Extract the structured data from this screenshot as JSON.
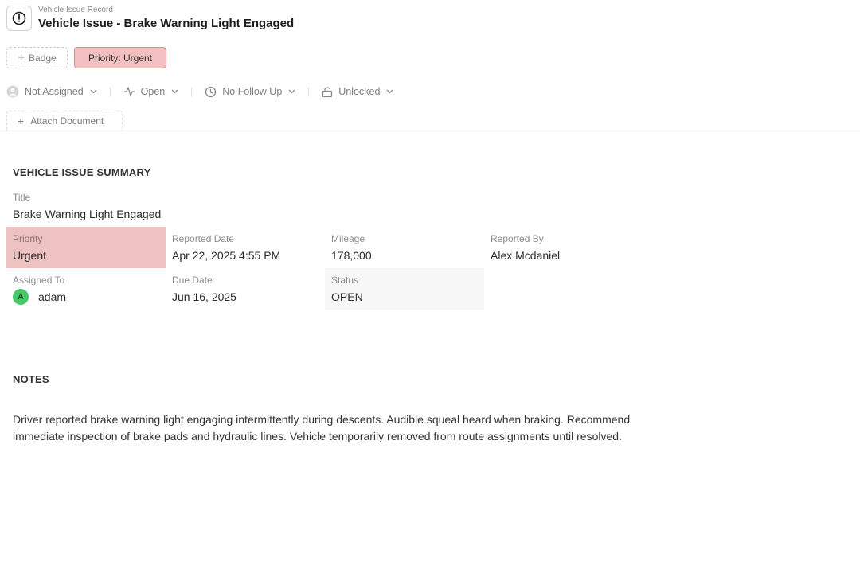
{
  "header": {
    "eyebrow": "Vehicle Issue Record",
    "title": "Vehicle Issue - Brake Warning Light Engaged",
    "icon": "alert-circle-icon"
  },
  "badges": {
    "add_label": "Badge",
    "priority_label": "Priority: Urgent",
    "priority_color": "#f2c0c0"
  },
  "meta": {
    "assignment": "Not Assigned",
    "status": "Open",
    "follow_up": "No Follow Up",
    "lock": "Unlocked"
  },
  "attach": {
    "label": "Attach Document"
  },
  "summary": {
    "heading": "VEHICLE ISSUE SUMMARY",
    "title_label": "Title",
    "title_value": "Brake Warning Light Engaged",
    "priority_label": "Priority",
    "priority_value": "Urgent",
    "reported_date_label": "Reported Date",
    "reported_date_value": "Apr 22, 2025 4:55 PM",
    "mileage_label": "Mileage",
    "mileage_value": "178,000",
    "reported_by_label": "Reported By",
    "reported_by_value": "Alex Mcdaniel",
    "assigned_to_label": "Assigned To",
    "assigned_to_initial": "A",
    "assigned_to_value": "adam",
    "due_date_label": "Due Date",
    "due_date_value": "Jun 16, 2025",
    "status_label": "Status",
    "status_value": "OPEN"
  },
  "notes": {
    "heading": "NOTES",
    "text": "Driver reported brake warning light engaging intermittently during descents. Audible squeal heard when braking. Recommend immediate inspection of brake pads and hydraulic lines. Vehicle temporarily removed from route assignments until resolved."
  },
  "colors": {
    "urgent_highlight": "#efc2c2",
    "avatar_green": "#47c96a"
  }
}
